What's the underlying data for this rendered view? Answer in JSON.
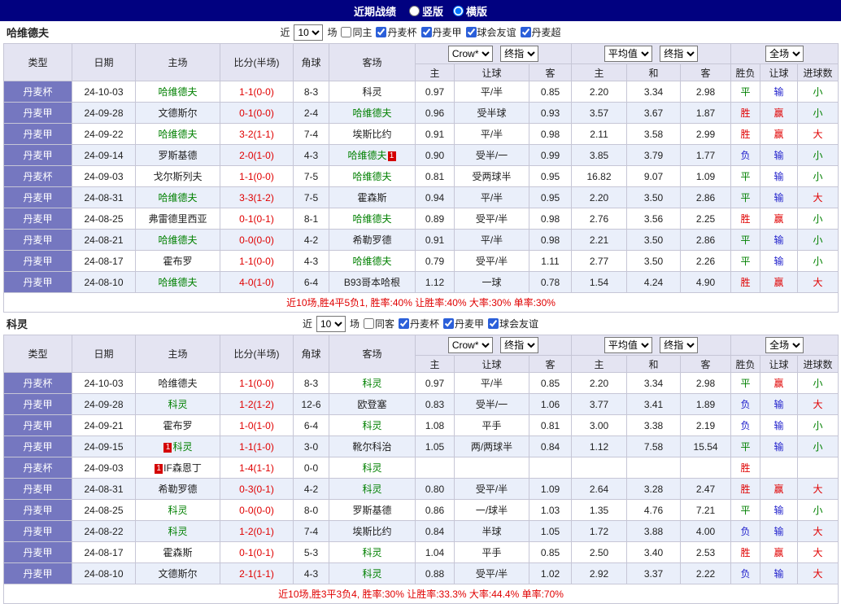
{
  "colors": {
    "topbar_navy": "#010180",
    "league_cell_purple": "#7577c0",
    "header_lavender": "#e4e4f2",
    "row_alt_blue": "#eaeffa",
    "team_green": "#008000",
    "score_red": "#e00000",
    "lose_blue": "#2222cc"
  },
  "top_bar": {
    "title": "近期战绩",
    "radios": [
      {
        "label": "竖版",
        "checked": false
      },
      {
        "label": "横版",
        "checked": true
      }
    ]
  },
  "labels": {
    "recent": "近",
    "matches": "场",
    "col_type": "类型",
    "col_date": "日期",
    "col_home": "主场",
    "col_score": "比分(半场)",
    "col_corner": "角球",
    "col_away": "客场",
    "sub": [
      "主",
      "让球",
      "客",
      "主",
      "和",
      "客",
      "胜负",
      "让球",
      "进球数"
    ]
  },
  "sections": [
    {
      "team": "哈维德夫",
      "filter": {
        "count": "10",
        "same_label": "同主",
        "same_checked": false,
        "leagues": [
          {
            "label": "丹麦杯",
            "checked": true
          },
          {
            "label": "丹麦甲",
            "checked": true
          },
          {
            "label": "球会友谊",
            "checked": true
          },
          {
            "label": "丹麦超",
            "checked": true
          }
        ]
      },
      "selects": {
        "bookmaker": "Crow*",
        "handicap_stage": "终指",
        "avg": "平均值",
        "avg_stage": "终指",
        "scope": "全场"
      },
      "footer": "近10场,胜4平5负1, 胜率:40% 让胜率:40% 大率:30% 单率:30%",
      "rows": [
        {
          "league": "丹麦杯",
          "date": "24-10-03",
          "home": {
            "text": "哈维德夫",
            "cls": "green"
          },
          "score": "1-1(0-0)",
          "corners": "8-3",
          "away": {
            "text": "科灵",
            "cls": "black"
          },
          "odds": [
            "0.97",
            "平/半",
            "0.85"
          ],
          "avg": [
            "2.20",
            "3.34",
            "2.98"
          ],
          "result": {
            "text": "平",
            "cls": "green"
          },
          "handicap": {
            "text": "输",
            "cls": "blue"
          },
          "goals": {
            "text": "小",
            "cls": "green"
          }
        },
        {
          "league": "丹麦甲",
          "date": "24-09-28",
          "home": {
            "text": "文德斯尔",
            "cls": "black"
          },
          "score": "0-1(0-0)",
          "corners": "2-4",
          "away": {
            "text": "哈维德夫",
            "cls": "green"
          },
          "odds": [
            "0.96",
            "受半球",
            "0.93"
          ],
          "avg": [
            "3.57",
            "3.67",
            "1.87"
          ],
          "result": {
            "text": "胜",
            "cls": "red"
          },
          "handicap": {
            "text": "赢",
            "cls": "red"
          },
          "goals": {
            "text": "小",
            "cls": "green"
          }
        },
        {
          "league": "丹麦甲",
          "date": "24-09-22",
          "home": {
            "text": "哈维德夫",
            "cls": "green"
          },
          "score": "3-2(1-1)",
          "corners": "7-4",
          "away": {
            "text": "埃斯比约",
            "cls": "black"
          },
          "odds": [
            "0.91",
            "平/半",
            "0.98"
          ],
          "avg": [
            "2.11",
            "3.58",
            "2.99"
          ],
          "result": {
            "text": "胜",
            "cls": "red"
          },
          "handicap": {
            "text": "赢",
            "cls": "red"
          },
          "goals": {
            "text": "大",
            "cls": "red"
          }
        },
        {
          "league": "丹麦甲",
          "date": "24-09-14",
          "home": {
            "text": "罗斯基德",
            "cls": "black"
          },
          "score": "2-0(1-0)",
          "corners": "4-3",
          "away": {
            "text": "哈维德夫",
            "cls": "green",
            "badge": "1",
            "badge_pos": "right"
          },
          "odds": [
            "0.90",
            "受半/一",
            "0.99"
          ],
          "avg": [
            "3.85",
            "3.79",
            "1.77"
          ],
          "result": {
            "text": "负",
            "cls": "blue"
          },
          "handicap": {
            "text": "输",
            "cls": "blue"
          },
          "goals": {
            "text": "小",
            "cls": "green"
          }
        },
        {
          "league": "丹麦杯",
          "date": "24-09-03",
          "home": {
            "text": "戈尔斯列夫",
            "cls": "black"
          },
          "score": "1-1(0-0)",
          "corners": "7-5",
          "away": {
            "text": "哈维德夫",
            "cls": "green"
          },
          "odds": [
            "0.81",
            "受两球半",
            "0.95"
          ],
          "avg": [
            "16.82",
            "9.07",
            "1.09"
          ],
          "result": {
            "text": "平",
            "cls": "green"
          },
          "handicap": {
            "text": "输",
            "cls": "blue"
          },
          "goals": {
            "text": "小",
            "cls": "green"
          }
        },
        {
          "league": "丹麦甲",
          "date": "24-08-31",
          "home": {
            "text": "哈维德夫",
            "cls": "green"
          },
          "score": "3-3(1-2)",
          "corners": "7-5",
          "away": {
            "text": "霍森斯",
            "cls": "black"
          },
          "odds": [
            "0.94",
            "平/半",
            "0.95"
          ],
          "avg": [
            "2.20",
            "3.50",
            "2.86"
          ],
          "result": {
            "text": "平",
            "cls": "green"
          },
          "handicap": {
            "text": "输",
            "cls": "blue"
          },
          "goals": {
            "text": "大",
            "cls": "red"
          }
        },
        {
          "league": "丹麦甲",
          "date": "24-08-25",
          "home": {
            "text": "弗雷德里西亚",
            "cls": "black"
          },
          "score": "0-1(0-1)",
          "corners": "8-1",
          "away": {
            "text": "哈维德夫",
            "cls": "green"
          },
          "odds": [
            "0.89",
            "受平/半",
            "0.98"
          ],
          "avg": [
            "2.76",
            "3.56",
            "2.25"
          ],
          "result": {
            "text": "胜",
            "cls": "red"
          },
          "handicap": {
            "text": "赢",
            "cls": "red"
          },
          "goals": {
            "text": "小",
            "cls": "green"
          }
        },
        {
          "league": "丹麦甲",
          "date": "24-08-21",
          "home": {
            "text": "哈维德夫",
            "cls": "green"
          },
          "score": "0-0(0-0)",
          "corners": "4-2",
          "away": {
            "text": "希勒罗德",
            "cls": "black"
          },
          "odds": [
            "0.91",
            "平/半",
            "0.98"
          ],
          "avg": [
            "2.21",
            "3.50",
            "2.86"
          ],
          "result": {
            "text": "平",
            "cls": "green"
          },
          "handicap": {
            "text": "输",
            "cls": "blue"
          },
          "goals": {
            "text": "小",
            "cls": "green"
          }
        },
        {
          "league": "丹麦甲",
          "date": "24-08-17",
          "home": {
            "text": "霍布罗",
            "cls": "black"
          },
          "score": "1-1(0-0)",
          "corners": "4-3",
          "away": {
            "text": "哈维德夫",
            "cls": "green"
          },
          "odds": [
            "0.79",
            "受平/半",
            "1.11"
          ],
          "avg": [
            "2.77",
            "3.50",
            "2.26"
          ],
          "result": {
            "text": "平",
            "cls": "green"
          },
          "handicap": {
            "text": "输",
            "cls": "blue"
          },
          "goals": {
            "text": "小",
            "cls": "green"
          }
        },
        {
          "league": "丹麦甲",
          "date": "24-08-10",
          "home": {
            "text": "哈维德夫",
            "cls": "green"
          },
          "score": "4-0(1-0)",
          "corners": "6-4",
          "away": {
            "text": "B93哥本哈根",
            "cls": "black"
          },
          "odds": [
            "1.12",
            "一球",
            "0.78"
          ],
          "avg": [
            "1.54",
            "4.24",
            "4.90"
          ],
          "result": {
            "text": "胜",
            "cls": "red"
          },
          "handicap": {
            "text": "赢",
            "cls": "red"
          },
          "goals": {
            "text": "大",
            "cls": "red"
          }
        }
      ]
    },
    {
      "team": "科灵",
      "filter": {
        "count": "10",
        "same_label": "同客",
        "same_checked": false,
        "leagues": [
          {
            "label": "丹麦杯",
            "checked": true
          },
          {
            "label": "丹麦甲",
            "checked": true
          },
          {
            "label": "球会友谊",
            "checked": true
          }
        ]
      },
      "selects": {
        "bookmaker": "Crow*",
        "handicap_stage": "终指",
        "avg": "平均值",
        "avg_stage": "终指",
        "scope": "全场"
      },
      "footer": "近10场,胜3平3负4, 胜率:30% 让胜率:33.3% 大率:44.4% 单率:70%",
      "rows": [
        {
          "league": "丹麦杯",
          "date": "24-10-03",
          "home": {
            "text": "哈维德夫",
            "cls": "black"
          },
          "score": "1-1(0-0)",
          "corners": "8-3",
          "away": {
            "text": "科灵",
            "cls": "green"
          },
          "odds": [
            "0.97",
            "平/半",
            "0.85"
          ],
          "avg": [
            "2.20",
            "3.34",
            "2.98"
          ],
          "result": {
            "text": "平",
            "cls": "green"
          },
          "handicap": {
            "text": "赢",
            "cls": "red"
          },
          "goals": {
            "text": "小",
            "cls": "green"
          }
        },
        {
          "league": "丹麦甲",
          "date": "24-09-28",
          "home": {
            "text": "科灵",
            "cls": "green"
          },
          "score": "1-2(1-2)",
          "corners": "12-6",
          "away": {
            "text": "欧登塞",
            "cls": "black"
          },
          "odds": [
            "0.83",
            "受半/一",
            "1.06"
          ],
          "avg": [
            "3.77",
            "3.41",
            "1.89"
          ],
          "result": {
            "text": "负",
            "cls": "blue"
          },
          "handicap": {
            "text": "输",
            "cls": "blue"
          },
          "goals": {
            "text": "大",
            "cls": "red"
          }
        },
        {
          "league": "丹麦甲",
          "date": "24-09-21",
          "home": {
            "text": "霍布罗",
            "cls": "black"
          },
          "score": "1-0(1-0)",
          "corners": "6-4",
          "away": {
            "text": "科灵",
            "cls": "green"
          },
          "odds": [
            "1.08",
            "平手",
            "0.81"
          ],
          "avg": [
            "3.00",
            "3.38",
            "2.19"
          ],
          "result": {
            "text": "负",
            "cls": "blue"
          },
          "handicap": {
            "text": "输",
            "cls": "blue"
          },
          "goals": {
            "text": "小",
            "cls": "green"
          }
        },
        {
          "league": "丹麦甲",
          "date": "24-09-15",
          "home": {
            "text": "科灵",
            "cls": "green",
            "badge": "1",
            "badge_pos": "left"
          },
          "score": "1-1(1-0)",
          "corners": "3-0",
          "away": {
            "text": "靴尔科治",
            "cls": "black"
          },
          "odds": [
            "1.05",
            "两/两球半",
            "0.84"
          ],
          "avg": [
            "1.12",
            "7.58",
            "15.54"
          ],
          "result": {
            "text": "平",
            "cls": "green"
          },
          "handicap": {
            "text": "输",
            "cls": "blue"
          },
          "goals": {
            "text": "小",
            "cls": "green"
          }
        },
        {
          "league": "丹麦杯",
          "date": "24-09-03",
          "home": {
            "text": "IF森恩丁",
            "cls": "black",
            "badge": "1",
            "badge_pos": "left"
          },
          "score": "1-4(1-1)",
          "corners": "0-0",
          "away": {
            "text": "科灵",
            "cls": "green"
          },
          "odds": [
            "",
            "",
            ""
          ],
          "avg": [
            "",
            "",
            ""
          ],
          "result": {
            "text": "胜",
            "cls": "red"
          },
          "handicap": {
            "text": "",
            "cls": "black"
          },
          "goals": {
            "text": "",
            "cls": "black"
          }
        },
        {
          "league": "丹麦甲",
          "date": "24-08-31",
          "home": {
            "text": "希勒罗德",
            "cls": "black"
          },
          "score": "0-3(0-1)",
          "corners": "4-2",
          "away": {
            "text": "科灵",
            "cls": "green"
          },
          "odds": [
            "0.80",
            "受平/半",
            "1.09"
          ],
          "avg": [
            "2.64",
            "3.28",
            "2.47"
          ],
          "result": {
            "text": "胜",
            "cls": "red"
          },
          "handicap": {
            "text": "赢",
            "cls": "red"
          },
          "goals": {
            "text": "大",
            "cls": "red"
          }
        },
        {
          "league": "丹麦甲",
          "date": "24-08-25",
          "home": {
            "text": "科灵",
            "cls": "green"
          },
          "score": "0-0(0-0)",
          "corners": "8-0",
          "away": {
            "text": "罗斯基德",
            "cls": "black"
          },
          "odds": [
            "0.86",
            "一/球半",
            "1.03"
          ],
          "avg": [
            "1.35",
            "4.76",
            "7.21"
          ],
          "result": {
            "text": "平",
            "cls": "green"
          },
          "handicap": {
            "text": "输",
            "cls": "blue"
          },
          "goals": {
            "text": "小",
            "cls": "green"
          }
        },
        {
          "league": "丹麦甲",
          "date": "24-08-22",
          "home": {
            "text": "科灵",
            "cls": "green"
          },
          "score": "1-2(0-1)",
          "corners": "7-4",
          "away": {
            "text": "埃斯比约",
            "cls": "black"
          },
          "odds": [
            "0.84",
            "半球",
            "1.05"
          ],
          "avg": [
            "1.72",
            "3.88",
            "4.00"
          ],
          "result": {
            "text": "负",
            "cls": "blue"
          },
          "handicap": {
            "text": "输",
            "cls": "blue"
          },
          "goals": {
            "text": "大",
            "cls": "red"
          }
        },
        {
          "league": "丹麦甲",
          "date": "24-08-17",
          "home": {
            "text": "霍森斯",
            "cls": "black"
          },
          "score": "0-1(0-1)",
          "corners": "5-3",
          "away": {
            "text": "科灵",
            "cls": "green"
          },
          "odds": [
            "1.04",
            "平手",
            "0.85"
          ],
          "avg": [
            "2.50",
            "3.40",
            "2.53"
          ],
          "result": {
            "text": "胜",
            "cls": "red"
          },
          "handicap": {
            "text": "赢",
            "cls": "red"
          },
          "goals": {
            "text": "大",
            "cls": "red"
          }
        },
        {
          "league": "丹麦甲",
          "date": "24-08-10",
          "home": {
            "text": "文德斯尔",
            "cls": "black"
          },
          "score": "2-1(1-1)",
          "corners": "4-3",
          "away": {
            "text": "科灵",
            "cls": "green"
          },
          "odds": [
            "0.88",
            "受平/半",
            "1.02"
          ],
          "avg": [
            "2.92",
            "3.37",
            "2.22"
          ],
          "result": {
            "text": "负",
            "cls": "blue"
          },
          "handicap": {
            "text": "输",
            "cls": "blue"
          },
          "goals": {
            "text": "大",
            "cls": "red"
          }
        }
      ]
    }
  ]
}
